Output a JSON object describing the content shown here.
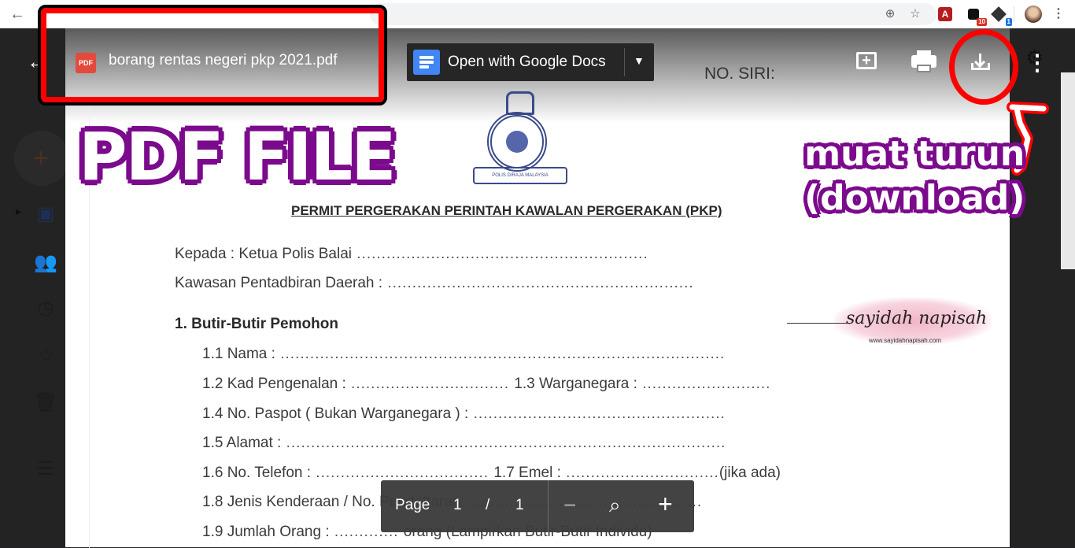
{
  "browser": {
    "back_icon": "arrow-left-icon",
    "extensions": [
      {
        "name": "zoom-icon",
        "glyph": "⊕"
      },
      {
        "name": "bookmark-star-icon",
        "glyph": "☆"
      },
      {
        "name": "acrobat-extension-icon",
        "glyph": "A"
      },
      {
        "name": "extension-badge-icon",
        "badge": "10",
        "badge_color": "#d93025"
      },
      {
        "name": "extension-cube-icon",
        "badge": "1",
        "badge_color": "#1a73e8"
      }
    ],
    "menu_icon": "more-vert-icon"
  },
  "viewer": {
    "file_icon_label": "PDF",
    "file_name": "borang rentas negeri pkp 2021.pdf",
    "open_with_label": "Open with Google Docs",
    "actions": [
      "add-comment-icon",
      "print-icon",
      "download-icon",
      "more-vert-icon"
    ]
  },
  "document": {
    "serial_label": "NO. SIRI:",
    "crest_caption": "POLIS DIRAJA MALAYSIA",
    "title": "PERMIT PERGERAKAN PERINTAH KAWALAN PERGERAKAN (PKP)",
    "to_line": "Kepada : Ketua Polis Balai",
    "district_line": "Kawasan Pentadbiran Daerah :",
    "section_title": "1.   Butir-Butir Pemohon",
    "fields": {
      "f11": "1.1 Nama :",
      "f12": "1.2 Kad Pengenalan :",
      "f13": "1.3  Warganegara :",
      "f14": "1.4 No. Paspot ( Bukan Warganegara ) :",
      "f15": "1.5 Alamat :",
      "f16": "1.6 No. Telefon :",
      "f17": "1.7   Emel :",
      "f17_suffix": "(jika ada)",
      "f18": "1.8 Jenis Kenderaan / No. Pendaftaran:",
      "f19": "1.9 Jumlah Orang :",
      "f19_suffix": "orang (Lampirkan Butir-Butir Individu)"
    }
  },
  "pagebar": {
    "page_label": "Page",
    "current_page": "1",
    "separator": "/",
    "total_pages": "1",
    "zoom_out": "−",
    "zoom_in": "+"
  },
  "annotations": {
    "pdf_file_label": "PDF FILE",
    "download_line1": "muat turun",
    "download_line2": "(download)",
    "highlight_color": "#ff0000",
    "label_color": "#7b0a8c"
  },
  "watermark": {
    "name": "sayidah napisah",
    "url": "www.sayidahnapisah.com"
  }
}
